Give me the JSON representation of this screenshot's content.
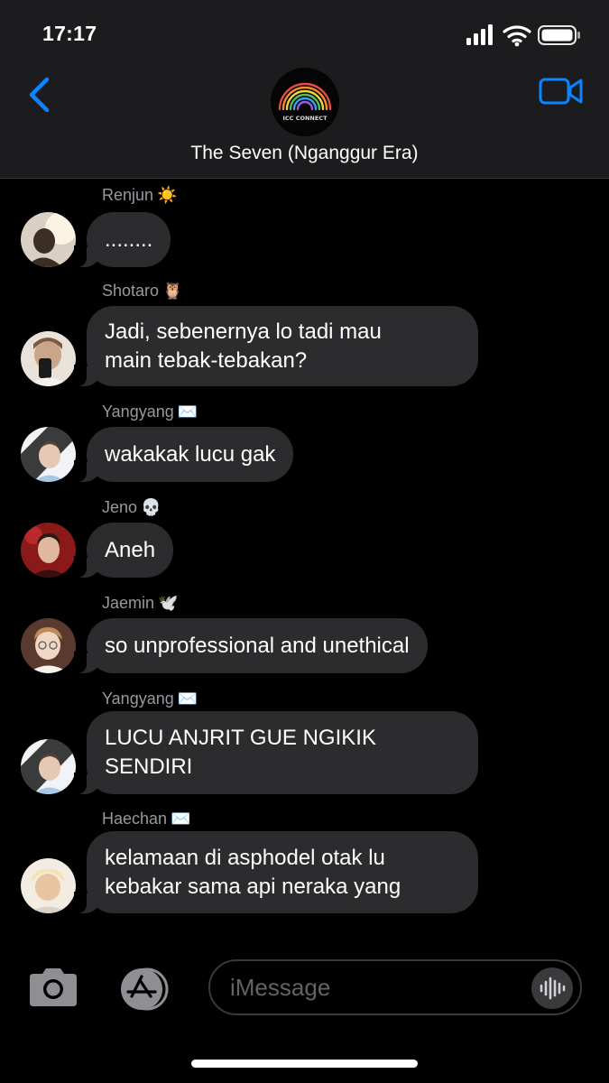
{
  "status": {
    "time": "17:17"
  },
  "header": {
    "title": "The Seven (Nganggur Era)",
    "avatar_text": "ICC CONNECT"
  },
  "messages": [
    {
      "sender": "Renjun",
      "emoji": "☀️",
      "lines": [
        "........"
      ]
    },
    {
      "sender": "Shotaro",
      "emoji": "🦉",
      "lines": [
        "Jadi, sebenernya lo tadi mau",
        "main tebak-tebakan?"
      ]
    },
    {
      "sender": "Yangyang",
      "emoji": "✉️",
      "lines": [
        "wakakak lucu gak"
      ]
    },
    {
      "sender": "Jeno",
      "emoji": "💀",
      "lines": [
        "Aneh"
      ]
    },
    {
      "sender": "Jaemin",
      "emoji": "🕊️",
      "lines": [
        "so unprofessional and unethical"
      ]
    },
    {
      "sender": "Yangyang",
      "emoji": "✉️",
      "lines": [
        "LUCU ANJRIT GUE NGIKIK",
        "SENDIRI"
      ]
    },
    {
      "sender": "Haechan",
      "emoji": "✉️",
      "lines": [
        "kelamaan di asphodel otak lu",
        "kebakar sama api neraka yang"
      ]
    }
  ],
  "input": {
    "placeholder": "iMessage"
  },
  "icons": {
    "back": "chevron-left-icon",
    "video": "video-camera-icon",
    "camera": "camera-icon",
    "apps": "app-store-icon",
    "voice": "waveform-icon"
  },
  "colors": {
    "accent": "#0a84ff",
    "bubble": "#2c2c2e",
    "header_bg": "#1c1c1e"
  }
}
